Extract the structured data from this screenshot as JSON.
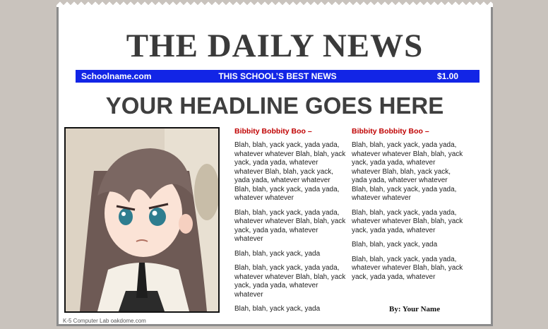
{
  "newspaper": {
    "masthead": "THE DAILY NEWS",
    "banner": {
      "left": "Schoolname.com",
      "center": "THIS SCHOOL’S  BEST NEWS",
      "right": "$1.00"
    },
    "headline": "YOUR HEADLINE GOES HERE",
    "photo_caption": "K-5 Computer Lab oakdome.com",
    "columns": [
      {
        "title": "Bibbity Bobbity Boo –",
        "paragraphs": [
          "Blah, blah, yack yack, yada yada, whatever whatever Blah, blah, yack yack, yada yada, whatever whatever Blah, blah, yack yack, yada yada, whatever whatever Blah, blah, yack yack, yada yada, whatever whatever",
          "Blah, blah, yack yack, yada yada, whatever whatever Blah, blah, yack yack, yada yada, whatever whatever",
          "Blah, blah, yack yack, yada",
          "Blah, blah, yack yack, yada yada, whatever whatever Blah, blah, yack yack, yada yada, whatever whatever",
          "Blah, blah, yack yack, yada"
        ]
      },
      {
        "title": "Bibbity Bobbity Boo –",
        "paragraphs": [
          "Blah, blah, yack yack, yada yada, whatever whatever Blah, blah, yack yack, yada yada, whatever whatever Blah, blah, yack yack, yada yada, whatever whatever Blah, blah, yack yack, yada yada, whatever whatever",
          "Blah, blah, yack yack, yada yada, whatever whatever Blah, blah, yack yack, yada yada, whatever",
          "Blah, blah, yack yack, yada",
          "Blah, blah, yack yack, yada yada, whatever whatever Blah, blah, yack yack, yada yada, whatever"
        ]
      }
    ],
    "byline": "By: Your Name"
  },
  "colors": {
    "banner": "#1225e6",
    "article_title": "#c00000",
    "masthead": "#3a3a3a"
  }
}
